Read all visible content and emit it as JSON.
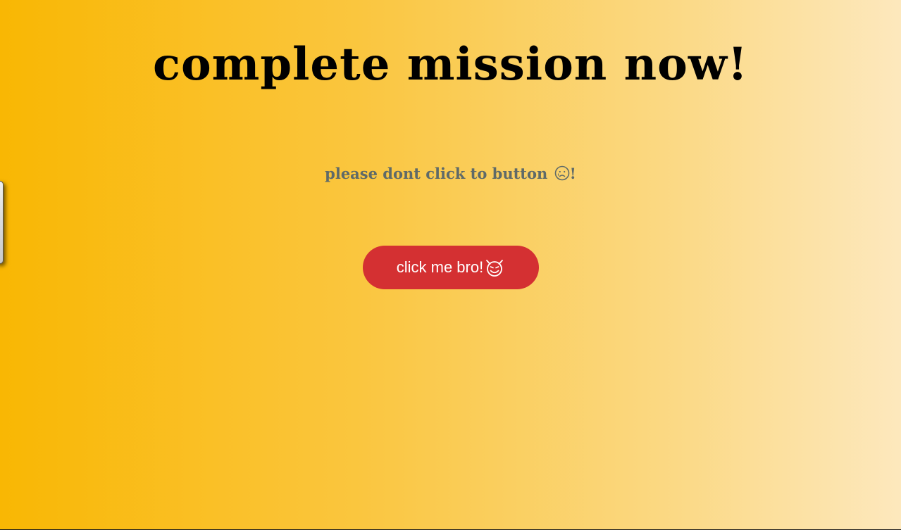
{
  "page": {
    "title": "complete mission now!",
    "subtitle_text": "please dont click to button ",
    "subtitle_emoji_icon": "sad-face-icon",
    "subtitle_suffix": "!"
  },
  "button": {
    "label": "click me bro!",
    "icon": "devil-face-icon"
  },
  "colors": {
    "gradient_start": "#f9b703",
    "gradient_end": "#fde8bd",
    "button_bg": "#d43032",
    "subtitle_text": "#5f6a68"
  }
}
